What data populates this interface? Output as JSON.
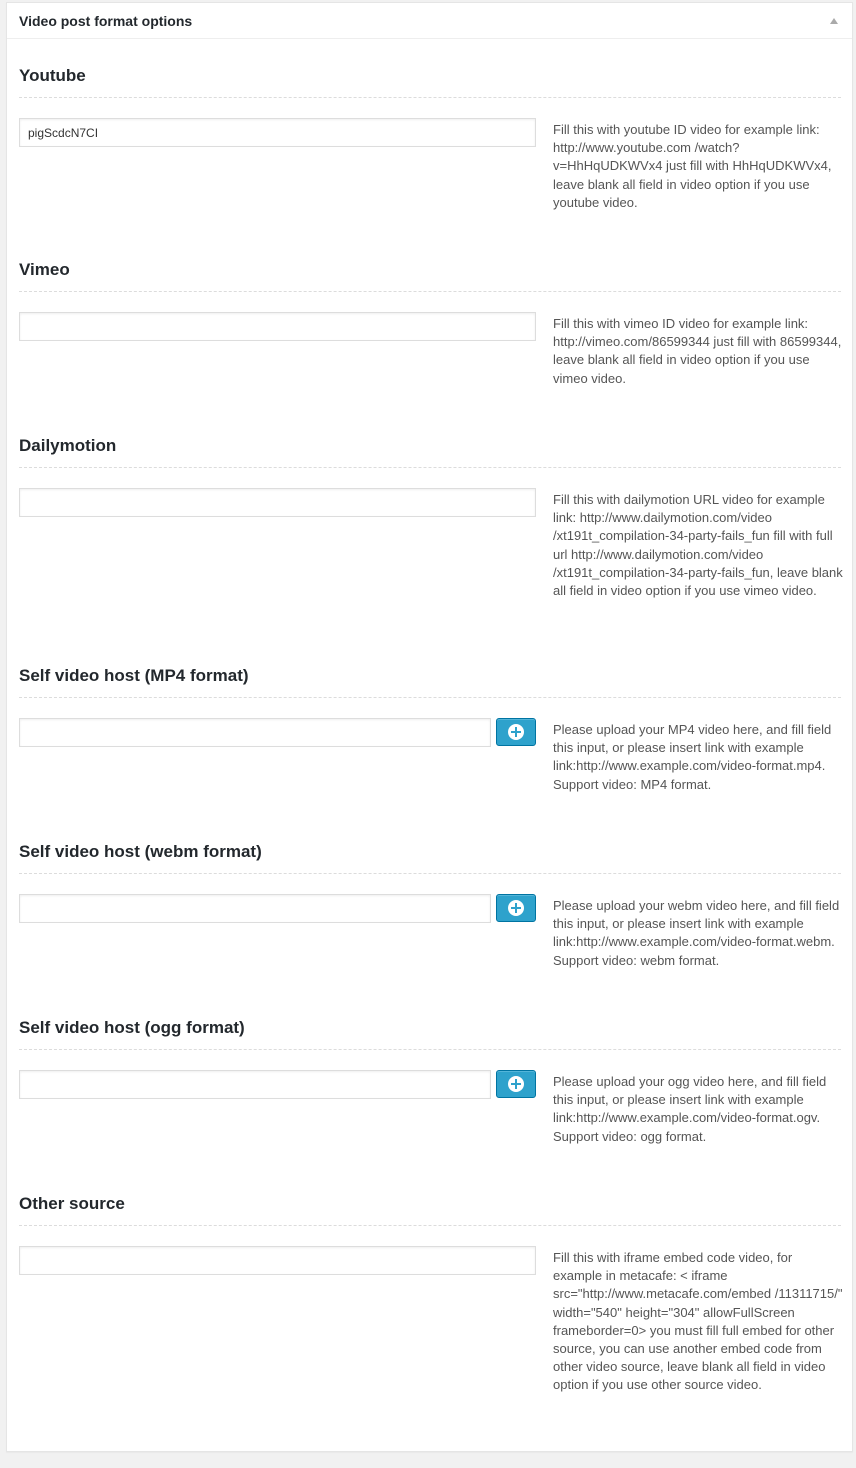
{
  "box": {
    "title": "Video post format options"
  },
  "fields": [
    {
      "label": "Youtube",
      "value": "pigScdcN7CI",
      "placeholder": "",
      "description": "Fill this with youtube ID video for example link: http://www.youtube.com /watch?v=HhHqUDKWVx4 just fill with HhHqUDKWVx4, leave blank all field in video option if you use youtube video."
    },
    {
      "label": "Vimeo",
      "value": "",
      "placeholder": "",
      "description": "Fill this with vimeo ID video for example link: http://vimeo.com/86599344 just fill with 86599344, leave blank all field in video option if you use vimeo video."
    },
    {
      "label": "Dailymotion",
      "value": "",
      "placeholder": "",
      "description": "Fill this with dailymotion URL video for example link: http://www.dailymotion.com/video /xt191t_compilation-34-party-fails_fun fill with full url http://www.dailymotion.com/video /xt191t_compilation-34-party-fails_fun, leave blank all field in video option if you use vimeo video."
    },
    {
      "label": "Self video host (MP4 format)",
      "value": "",
      "placeholder": "",
      "description": "Please upload your MP4 video here, and fill field this input, or please insert link with example link:http://www.example.com/video-format.mp4. Support video: MP4 format."
    },
    {
      "label": "Self video host (webm format)",
      "value": "",
      "placeholder": "",
      "description": "Please upload your webm video here, and fill field this input, or please insert link with example link:http://www.example.com/video-format.webm. Support video: webm format."
    },
    {
      "label": "Self video host (ogg format)",
      "value": "",
      "placeholder": "",
      "description": "Please upload your ogg video here, and fill field this input, or please insert link with example link:http://www.example.com/video-format.ogv. Support video: ogg format."
    },
    {
      "label": "Other source",
      "value": "",
      "placeholder": "",
      "description": "Fill this with iframe embed code video, for example in metacafe: < iframe src=\"http://www.metacafe.com/embed /11311715/\" width=\"540\" height=\"304\" allowFullScreen frameborder=0> you must fill full embed for other source, you can use another embed code from other video source, leave blank all field in video option if you use other source video."
    }
  ],
  "icons": {
    "toggle": "triangle-up-icon",
    "upload": "plus-circle-icon"
  },
  "colors": {
    "upload_button": "#2ea2cc",
    "upload_border": "#0074a2"
  }
}
